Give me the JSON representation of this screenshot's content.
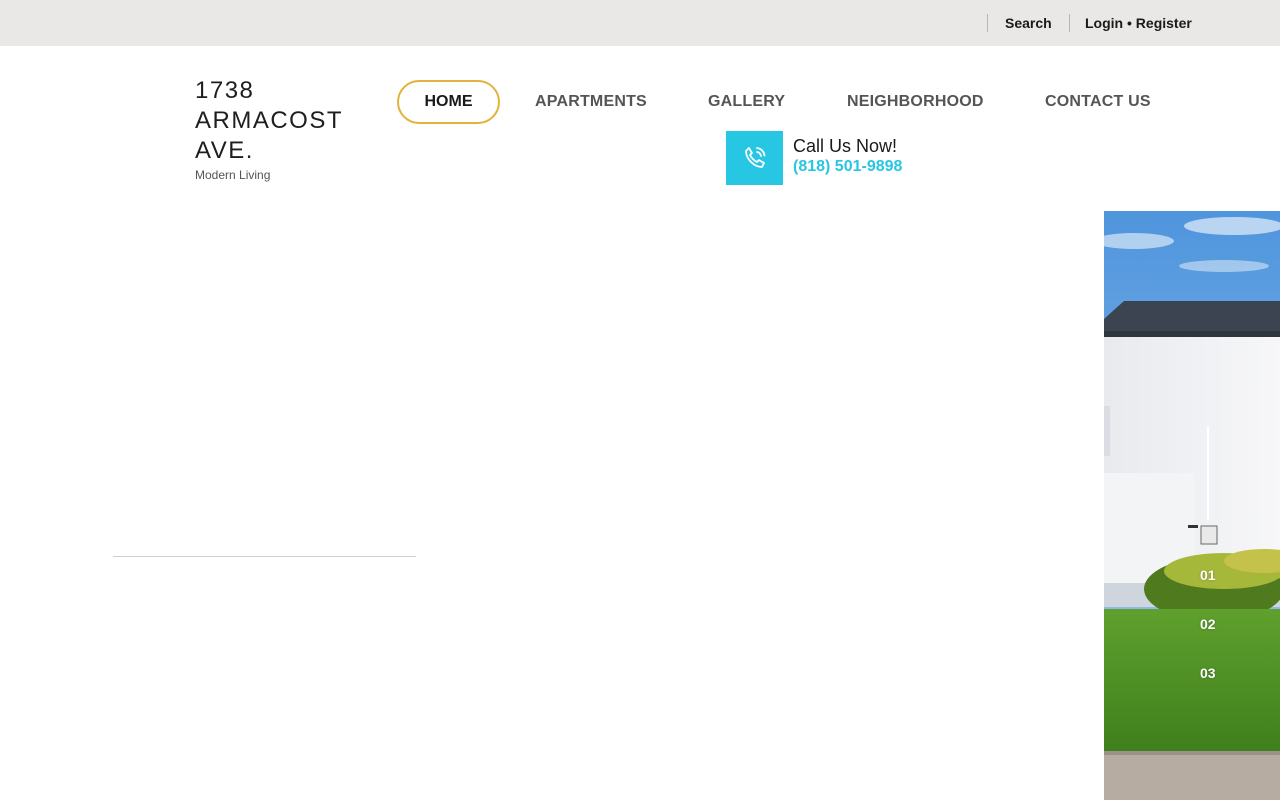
{
  "topbar": {
    "search_label": "Search",
    "login_label": "Login",
    "bullet": "•",
    "register_label": "Register"
  },
  "logo": {
    "title": "1738 ARMACOST AVE.",
    "subtitle": "Modern Living"
  },
  "nav": {
    "items": [
      {
        "label": "HOME",
        "active": true
      },
      {
        "label": "APARTMENTS"
      },
      {
        "label": "GALLERY"
      },
      {
        "label": "NEIGHBORHOOD"
      },
      {
        "label": "CONTACT US"
      }
    ]
  },
  "call": {
    "label": "Call Us Now!",
    "phone": "(818) 501-9898",
    "icon": "phone-icon"
  },
  "slider": {
    "numbers": [
      "01",
      "02",
      "03"
    ],
    "active_index": 0
  },
  "colors": {
    "accent_teal": "#27c6e3",
    "accent_gold": "#e2b33a",
    "topbar_bg": "#eae8e6"
  }
}
